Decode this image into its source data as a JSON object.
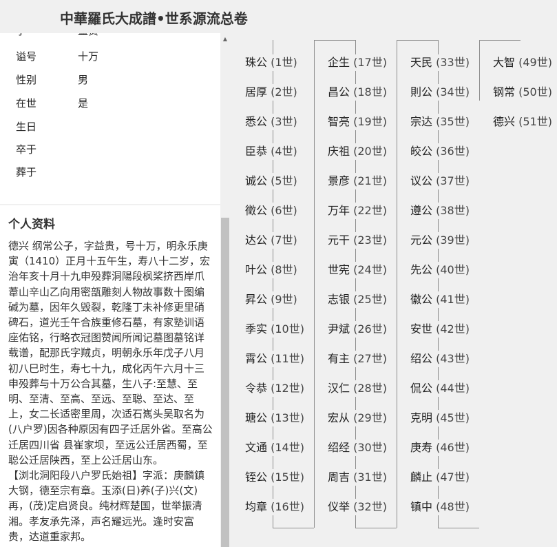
{
  "header": {
    "title": "中華羅氏大成譜•世系源流总卷"
  },
  "profile": {
    "partial_row": {
      "label": "字",
      "value": "益贵"
    },
    "rows": [
      {
        "label": "谥号",
        "value": "十万"
      },
      {
        "label": "性别",
        "value": "男"
      },
      {
        "label": "在世",
        "value": "是"
      },
      {
        "label": "生日",
        "value": ""
      },
      {
        "label": "卒于",
        "value": ""
      },
      {
        "label": "葬于",
        "value": ""
      }
    ]
  },
  "bio": {
    "title": "个人资料",
    "text": "德兴 纲常公子，字益贵，号十万，明永乐庚寅（1410）正月十五午生，寿八十二岁，宏治年亥十月十九申殁葬洞陽段枫桨挤西岸爪葦山辛山乙向用密瓿雕刻人物故事数十图编碱为墓，因年久毁裂，乾隆丁未补修更里硝碑石，道光壬午合族重修石墓，有家塾训语座佑铭，行略衣冠图赞闻所闻记墓图墓铭详载谱，配那氏字羢贞，明朝永乐年戊子八月初八巳时生，寿七十九，成化丙午六月十三申殁葬与十万公合其墓，生八子:至慧、至明、至清、至高、至远、至聪、至达、至上，女二长适密里周，次适石嶲头吴取名为(八户罗)因各种原因有四子迁居外省。至高公迁居四川省 县崔家坝，至远公迁居西蜀，至聪公迁居陕西，至上公迁居山东。\n【浏北洞阳段八户罗氏始祖】字派：庚麟鎮大钢，德至宗有章。玉添(日)养(子)兴(文)再，(茂)定启贤良。纯材辉楚国，世举振清湘。孝友承先泽，声名耀远光。逢时安富贵，达道重家邦。"
  },
  "lineage": {
    "columns": [
      [
        {
          "name": "珠公",
          "gen": "(1世)"
        },
        {
          "name": "居厚",
          "gen": "(2世)"
        },
        {
          "name": "悉公",
          "gen": "(3世)"
        },
        {
          "name": "臣恭",
          "gen": "(4世)"
        },
        {
          "name": "诚公",
          "gen": "(5世)"
        },
        {
          "name": "徵公",
          "gen": "(6世)"
        },
        {
          "name": "达公",
          "gen": "(7世)"
        },
        {
          "name": "叶公",
          "gen": "(8世)"
        },
        {
          "name": "昇公",
          "gen": "(9世)"
        },
        {
          "name": "季实",
          "gen": "(10世)"
        },
        {
          "name": "霄公",
          "gen": "(11世)"
        },
        {
          "name": "令恭",
          "gen": "(12世)"
        },
        {
          "name": "瑭公",
          "gen": "(13世)"
        },
        {
          "name": "文通",
          "gen": "(14世)"
        },
        {
          "name": "铚公",
          "gen": "(15世)"
        },
        {
          "name": "均章",
          "gen": "(16世)"
        }
      ],
      [
        {
          "name": "企生",
          "gen": "(17世)"
        },
        {
          "name": "昌公",
          "gen": "(18世)"
        },
        {
          "name": "智亮",
          "gen": "(19世)"
        },
        {
          "name": "庆祖",
          "gen": "(20世)"
        },
        {
          "name": "景彦",
          "gen": "(21世)"
        },
        {
          "name": "万年",
          "gen": "(22世)"
        },
        {
          "name": "元干",
          "gen": "(23世)"
        },
        {
          "name": "世宪",
          "gen": "(24世)"
        },
        {
          "name": "志银",
          "gen": "(25世)"
        },
        {
          "name": "尹斌",
          "gen": "(26世)"
        },
        {
          "name": "有主",
          "gen": "(27世)"
        },
        {
          "name": "汉仁",
          "gen": "(28世)"
        },
        {
          "name": "宏从",
          "gen": "(29世)"
        },
        {
          "name": "绍经",
          "gen": "(30世)"
        },
        {
          "name": "周吉",
          "gen": "(31世)"
        },
        {
          "name": "仪举",
          "gen": "(32世)"
        }
      ],
      [
        {
          "name": "天民",
          "gen": "(33世)"
        },
        {
          "name": "則公",
          "gen": "(34世)"
        },
        {
          "name": "宗达",
          "gen": "(35世)"
        },
        {
          "name": "皎公",
          "gen": "(36世)"
        },
        {
          "name": "议公",
          "gen": "(37世)"
        },
        {
          "name": "遵公",
          "gen": "(38世)"
        },
        {
          "name": "元公",
          "gen": "(39世)"
        },
        {
          "name": "先公",
          "gen": "(40世)"
        },
        {
          "name": "徽公",
          "gen": "(41世)"
        },
        {
          "name": "安世",
          "gen": "(42世)"
        },
        {
          "name": "绍公",
          "gen": "(43世)"
        },
        {
          "name": "侃公",
          "gen": "(44世)"
        },
        {
          "name": "克明",
          "gen": "(45世)"
        },
        {
          "name": "庚寿",
          "gen": "(46世)"
        },
        {
          "name": "麟止",
          "gen": "(47世)"
        },
        {
          "name": "镇中",
          "gen": "(48世)"
        }
      ],
      [
        {
          "name": "大智",
          "gen": "(49世)"
        },
        {
          "name": "钢常",
          "gen": "(50世)"
        },
        {
          "name": "德兴",
          "gen": "(51世)"
        }
      ]
    ]
  }
}
